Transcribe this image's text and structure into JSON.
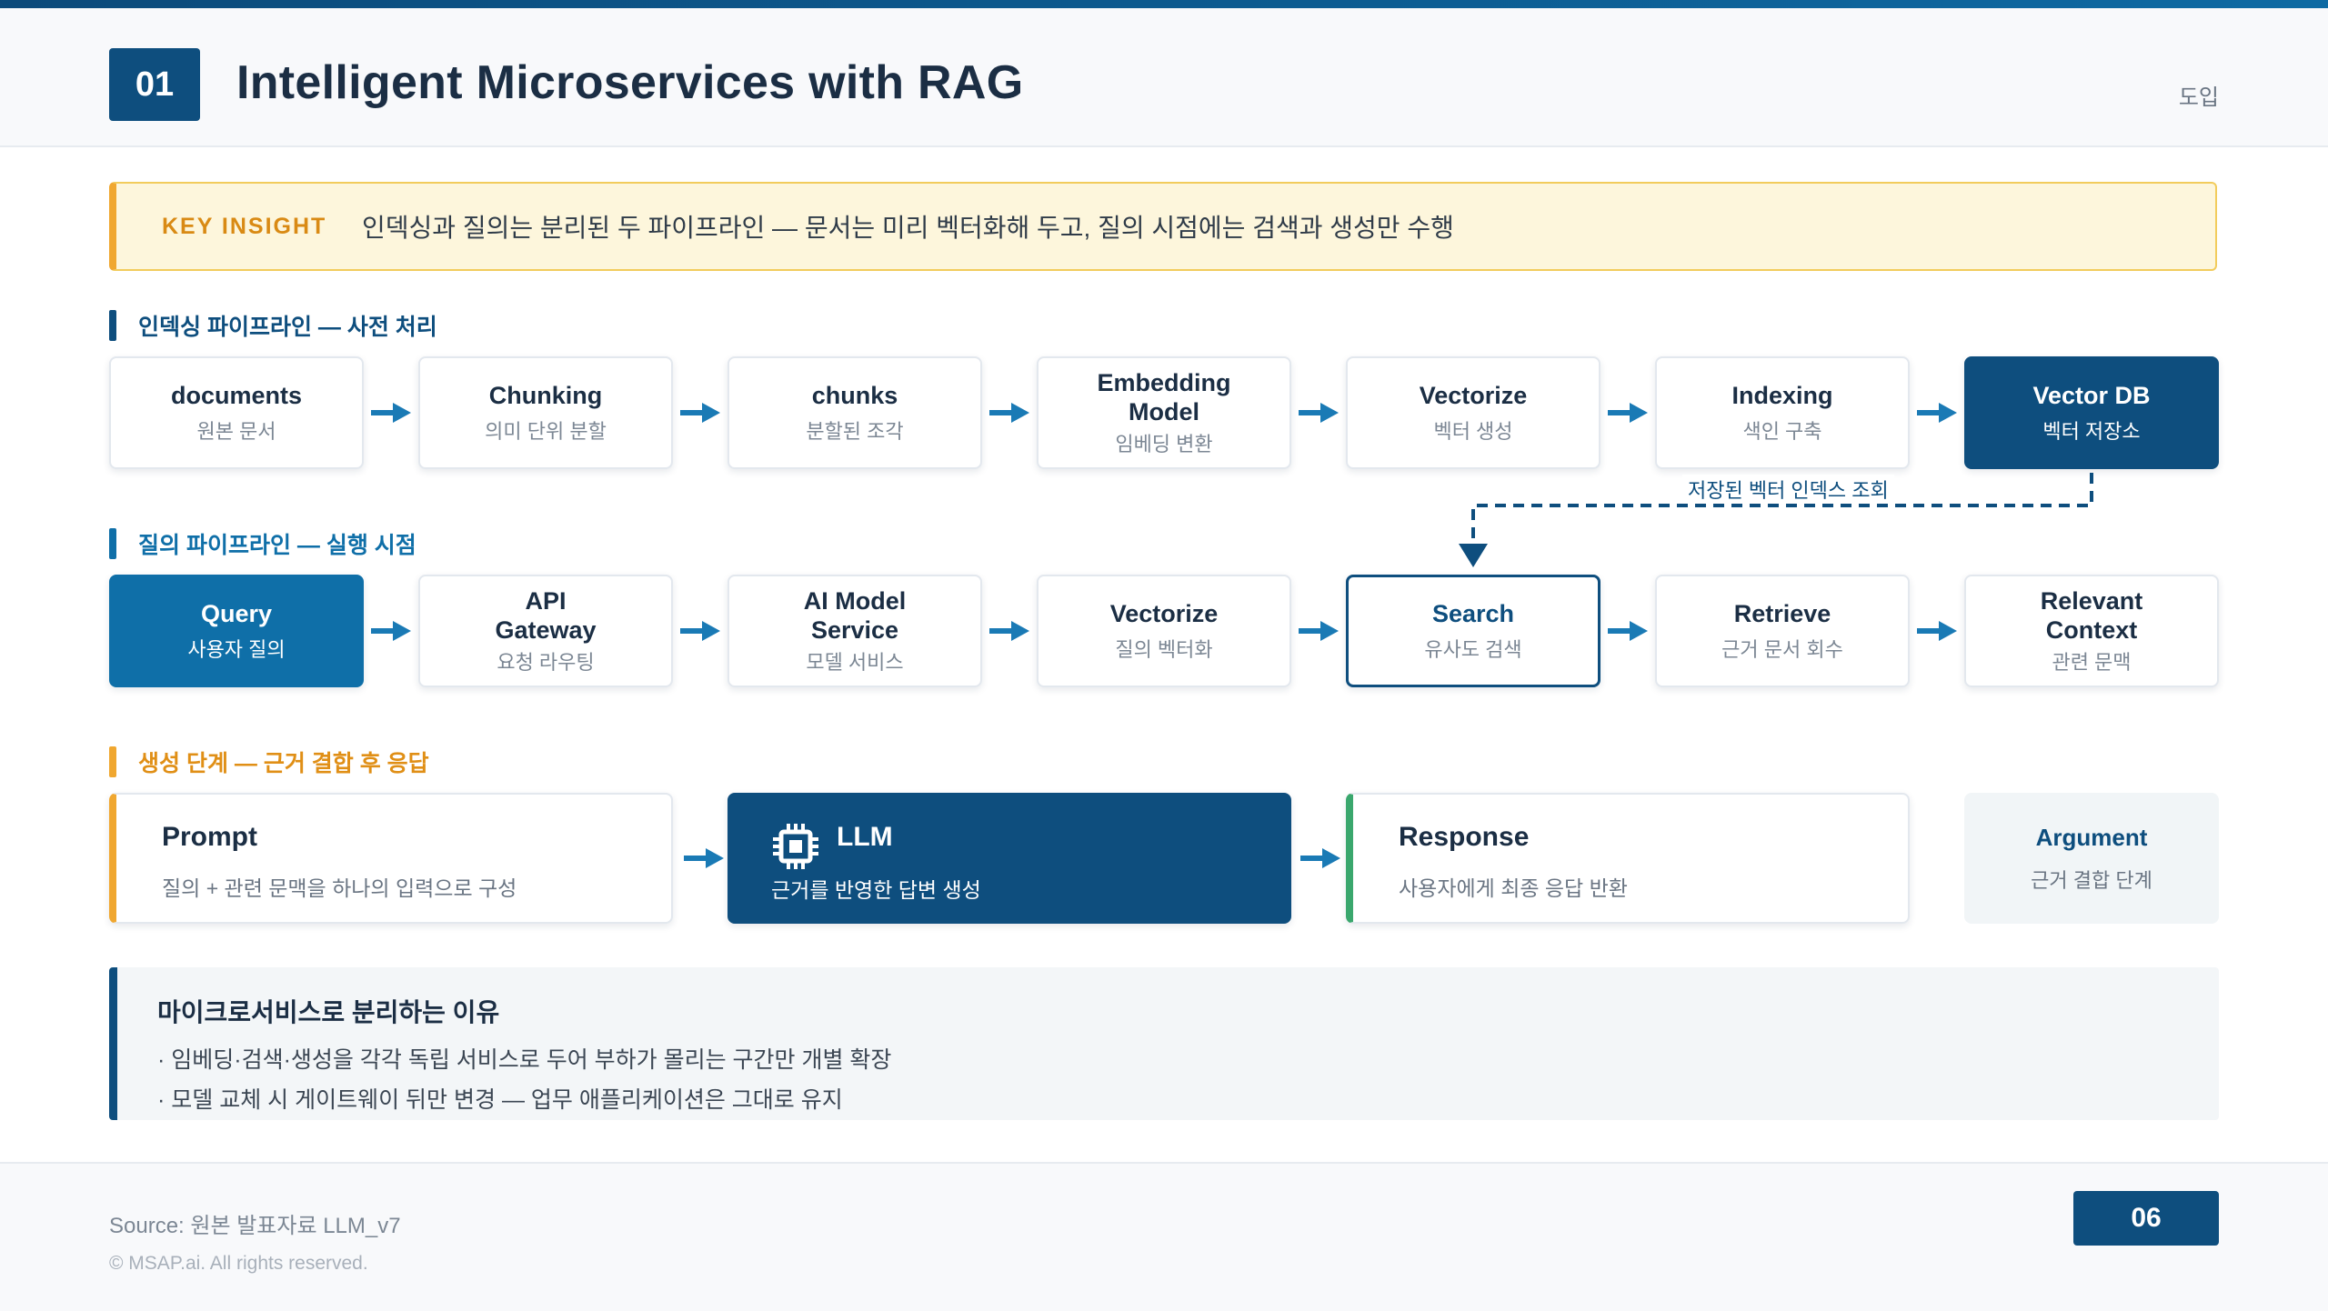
{
  "header": {
    "number": "01",
    "title": "Intelligent Microservices with RAG",
    "section": "도입"
  },
  "insight": {
    "label": "KEY INSIGHT",
    "text": "인덱싱과 질의는 분리된 두 파이프라인 — 문서는 미리 벡터화해 두고, 질의 시점에는 검색과 생성만 수행"
  },
  "indexing": {
    "heading": "인덱싱 파이프라인 — 사전 처리",
    "nodes": [
      {
        "title": "documents",
        "sub": "원본 문서"
      },
      {
        "title": "Chunking",
        "sub": "의미 단위 분할"
      },
      {
        "title": "chunks",
        "sub": "분할된 조각"
      },
      {
        "title": "Embedding Model",
        "sub": "임베딩 변환"
      },
      {
        "title": "Vectorize",
        "sub": "벡터 생성"
      },
      {
        "title": "Indexing",
        "sub": "색인 구축"
      },
      {
        "title": "Vector DB",
        "sub": "벡터 저장소"
      }
    ],
    "link_label": "저장된 벡터 인덱스 조회"
  },
  "query": {
    "heading": "질의 파이프라인 — 실행 시점",
    "nodes": [
      {
        "title": "Query",
        "sub": "사용자 질의"
      },
      {
        "title": "API Gateway",
        "sub": "요청 라우팅"
      },
      {
        "title": "AI Model Service",
        "sub": "모델 서비스"
      },
      {
        "title": "Vectorize",
        "sub": "질의 벡터화"
      },
      {
        "title": "Search",
        "sub": "유사도 검색"
      },
      {
        "title": "Retrieve",
        "sub": "근거 문서 회수"
      },
      {
        "title": "Relevant Context",
        "sub": "관련 문맥"
      }
    ]
  },
  "generation": {
    "heading": "생성 단계 — 근거 결합 후 응답",
    "prompt": {
      "title": "Prompt",
      "sub": "질의 + 관련 문맥을 하나의 입력으로 구성"
    },
    "llm": {
      "title": "LLM",
      "sub": "근거를 반영한 답변 생성",
      "icon": "chip-icon"
    },
    "response": {
      "title": "Response",
      "sub": "사용자에게 최종 응답 반환"
    },
    "argument": {
      "title": "Argument",
      "sub": "근거 결합 단계"
    }
  },
  "why": {
    "title": "마이크로서비스로 분리하는 이유",
    "lines": [
      "· 임베딩·검색·생성을 각각 독립 서비스로 두어 부하가 몰리는 구간만 개별 확장",
      "· 모델 교체 시 게이트웨이 뒤만 변경 — 업무 애플리케이션은 그대로 유지"
    ]
  },
  "footer": {
    "source": "Source: 원본 발표자료 LLM_v7",
    "copyright": "© MSAP.ai. All rights reserved.",
    "page": "06"
  },
  "colors": {
    "navy": "#0e4e7e",
    "blue": "#0f6fa8",
    "amber": "#f0a730",
    "green": "#3aa76d",
    "arrow": "#1a7ab5"
  }
}
